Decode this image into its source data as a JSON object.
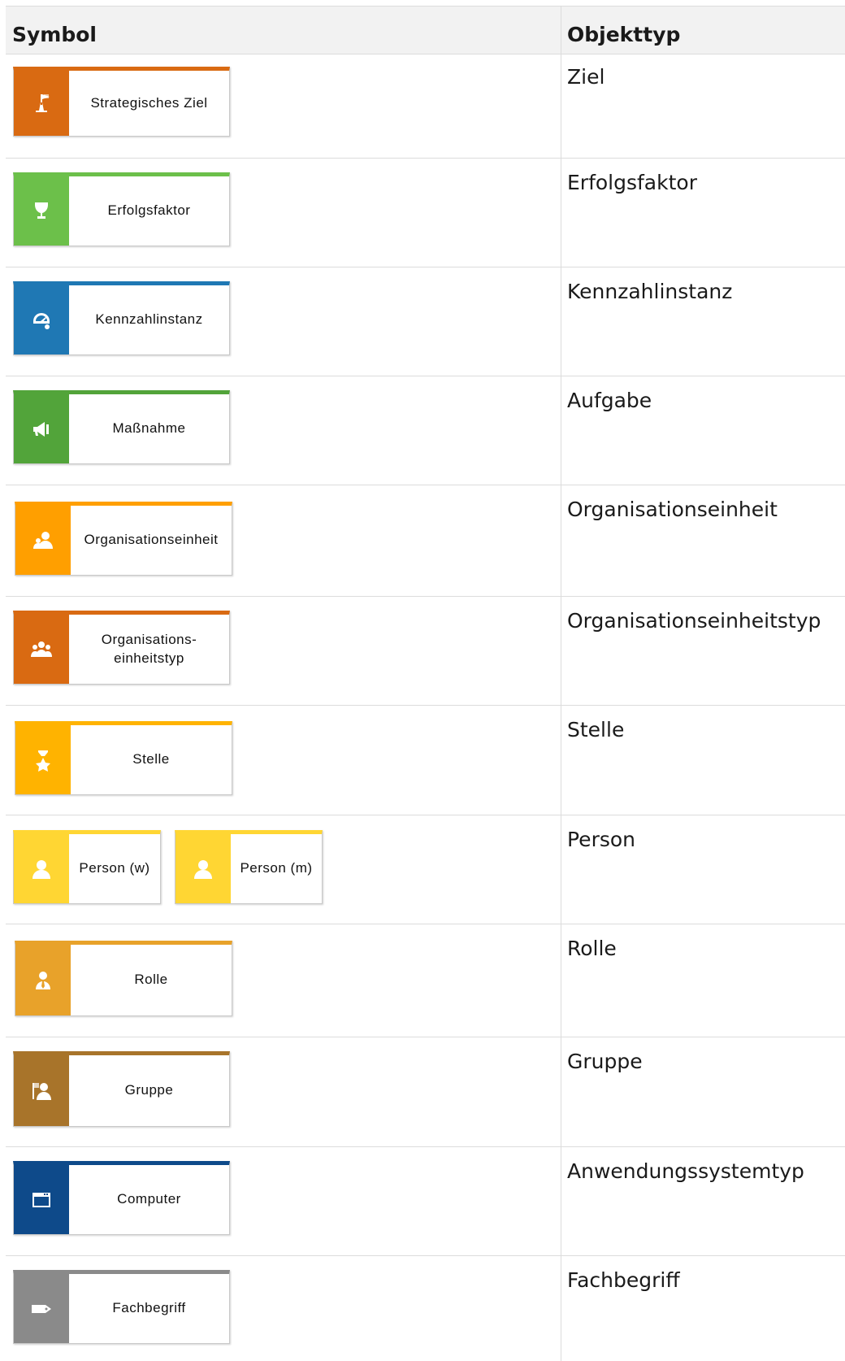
{
  "table": {
    "headers": {
      "symbol": "Symbol",
      "object_type": "Objekttyp"
    },
    "rows": [
      {
        "symbols": [
          {
            "label": "Strategisches Ziel",
            "color": "#d96a12",
            "icon": "goal-flag-icon"
          }
        ],
        "type": "Ziel"
      },
      {
        "symbols": [
          {
            "label": "Erfolgsfaktor",
            "color": "#6cc04a",
            "icon": "trophy-icon"
          }
        ],
        "type": "Erfolgsfaktor"
      },
      {
        "symbols": [
          {
            "label": "Kennzahlinstanz",
            "color": "#1f78b4",
            "icon": "gauge-icon"
          }
        ],
        "type": "Kennzahlinstanz"
      },
      {
        "symbols": [
          {
            "label": "Maßnahme",
            "color": "#52a43a",
            "icon": "megaphone-icon"
          }
        ],
        "type": "Aufgabe"
      },
      {
        "symbols": [
          {
            "label": "Organisationseinheit",
            "color": "#ff9f00",
            "icon": "org-unit-icon"
          }
        ],
        "type": "Organisationseinheit"
      },
      {
        "symbols": [
          {
            "label": "Organisations-\neinheitstyp",
            "color": "#d96a12",
            "icon": "org-unit-type-icon"
          }
        ],
        "type": "Organisationseinheitstyp"
      },
      {
        "symbols": [
          {
            "label": "Stelle",
            "color": "#ffb300",
            "icon": "position-icon"
          }
        ],
        "type": "Stelle"
      },
      {
        "symbols": [
          {
            "label": "Person (w)",
            "color": "#ffd633",
            "icon": "person-icon"
          },
          {
            "label": "Person (m)",
            "color": "#ffd633",
            "icon": "person-icon"
          }
        ],
        "type": "Person"
      },
      {
        "symbols": [
          {
            "label": "Rolle",
            "color": "#e8a22a",
            "icon": "role-icon"
          }
        ],
        "type": "Rolle"
      },
      {
        "symbols": [
          {
            "label": "Gruppe",
            "color": "#a8742a",
            "icon": "group-icon"
          }
        ],
        "type": "Gruppe"
      },
      {
        "symbols": [
          {
            "label": "Computer",
            "color": "#0e4a8a",
            "icon": "window-icon"
          }
        ],
        "type": "Anwendungssystemtyp"
      },
      {
        "symbols": [
          {
            "label": "Fachbegriff",
            "color": "#8a8a8a",
            "icon": "tag-icon"
          }
        ],
        "type": "Fachbegriff"
      }
    ]
  }
}
